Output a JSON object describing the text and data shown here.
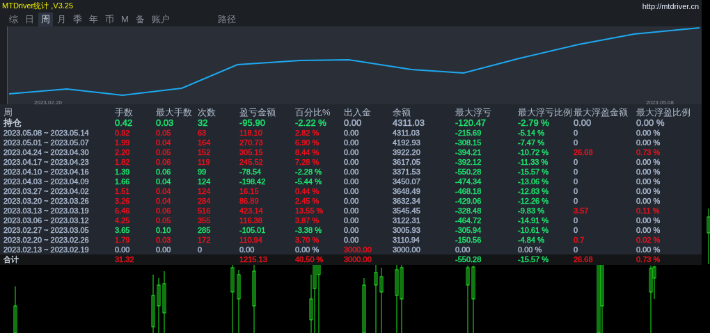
{
  "window": {
    "title": "MTDriver统计 ,V3.25",
    "link": "http://mtdriver.cn"
  },
  "tabs": [
    {
      "label": "综",
      "selected": false
    },
    {
      "label": "日",
      "selected": false
    },
    {
      "label": "周",
      "selected": true
    },
    {
      "label": "月",
      "selected": false
    },
    {
      "label": "季",
      "selected": false
    },
    {
      "label": "年",
      "selected": false
    },
    {
      "label": "币",
      "selected": false
    },
    {
      "label": "M",
      "selected": false
    },
    {
      "label": "备",
      "selected": false
    },
    {
      "label": "账户",
      "selected": false
    },
    {
      "label": "路径",
      "selected": false
    }
  ],
  "equity_chart": {
    "start_date": "2023.02.20",
    "end_date": "2023.05.08"
  },
  "table": {
    "columns": [
      "周",
      "手数",
      "最大手数",
      "次数",
      "盈亏金额",
      "百分比%",
      "出入金",
      "余额",
      "最大浮亏",
      "最大浮亏比例",
      "最大浮盈金额",
      "最大浮盈比例"
    ],
    "rows": [
      {
        "kind": "open",
        "cells": [
          {
            "text": "持仓",
            "color": "#c9d2de"
          },
          {
            "text": "0.42",
            "color": "#1ee870"
          },
          {
            "text": "0.03",
            "color": "#1ee870"
          },
          {
            "text": "32",
            "color": "#1ee870"
          },
          {
            "text": "-95.90",
            "color": "#1ee870"
          },
          {
            "text": "-2.22 %",
            "color": "#1ee870"
          },
          {
            "text": "0.00",
            "color": "#a9b8cf"
          },
          {
            "text": "4311.03",
            "color": "#a9b8cf"
          },
          {
            "text": "-120.47",
            "color": "#1ee870"
          },
          {
            "text": "-2.79 %",
            "color": "#1ee870"
          },
          {
            "text": "0.00",
            "color": "#a9b8cf"
          },
          {
            "text": "0.00 %",
            "color": "#a9b8cf"
          }
        ]
      },
      {
        "kind": "week",
        "cells": [
          {
            "text": "2023.05.08 ~ 2023.05.14",
            "color": "#a9b8cf"
          },
          {
            "text": "0.92",
            "color": "#f0101c"
          },
          {
            "text": "0.05",
            "color": "#f0101c"
          },
          {
            "text": "63",
            "color": "#f0101c"
          },
          {
            "text": "118.10",
            "color": "#f0101c"
          },
          {
            "text": "2.82 %",
            "color": "#f0101c"
          },
          {
            "text": "0.00",
            "color": "#a9b8cf"
          },
          {
            "text": "4311.03",
            "color": "#a9b8cf"
          },
          {
            "text": "-215.69",
            "color": "#1ee870"
          },
          {
            "text": "-5.14 %",
            "color": "#1ee870"
          },
          {
            "text": "0",
            "color": "#a9b8cf"
          },
          {
            "text": "0.00 %",
            "color": "#a9b8cf"
          }
        ]
      },
      {
        "kind": "week",
        "cells": [
          {
            "text": "2023.05.01 ~ 2023.05.07",
            "color": "#a9b8cf"
          },
          {
            "text": "1.99",
            "color": "#f0101c"
          },
          {
            "text": "0.04",
            "color": "#f0101c"
          },
          {
            "text": "164",
            "color": "#f0101c"
          },
          {
            "text": "270.73",
            "color": "#f0101c"
          },
          {
            "text": "6.90 %",
            "color": "#f0101c"
          },
          {
            "text": "0.00",
            "color": "#a9b8cf"
          },
          {
            "text": "4192.93",
            "color": "#a9b8cf"
          },
          {
            "text": "-308.15",
            "color": "#1ee870"
          },
          {
            "text": "-7.47 %",
            "color": "#1ee870"
          },
          {
            "text": "0",
            "color": "#a9b8cf"
          },
          {
            "text": "0.00 %",
            "color": "#a9b8cf"
          }
        ]
      },
      {
        "kind": "week",
        "cells": [
          {
            "text": "2023.04.24 ~ 2023.04.30",
            "color": "#a9b8cf"
          },
          {
            "text": "2.20",
            "color": "#f0101c"
          },
          {
            "text": "0.05",
            "color": "#f0101c"
          },
          {
            "text": "152",
            "color": "#f0101c"
          },
          {
            "text": "305.15",
            "color": "#f0101c"
          },
          {
            "text": "8.44 %",
            "color": "#f0101c"
          },
          {
            "text": "0.00",
            "color": "#a9b8cf"
          },
          {
            "text": "3922.20",
            "color": "#a9b8cf"
          },
          {
            "text": "-394.21",
            "color": "#1ee870"
          },
          {
            "text": "-10.72 %",
            "color": "#1ee870"
          },
          {
            "text": "26.68",
            "color": "#f0101c"
          },
          {
            "text": "0.73 %",
            "color": "#f0101c"
          }
        ]
      },
      {
        "kind": "week",
        "cells": [
          {
            "text": "2023.04.17 ~ 2023.04.23",
            "color": "#a9b8cf"
          },
          {
            "text": "1.82",
            "color": "#f0101c"
          },
          {
            "text": "0.06",
            "color": "#f0101c"
          },
          {
            "text": "119",
            "color": "#f0101c"
          },
          {
            "text": "245.52",
            "color": "#f0101c"
          },
          {
            "text": "7.28 %",
            "color": "#f0101c"
          },
          {
            "text": "0.00",
            "color": "#a9b8cf"
          },
          {
            "text": "3617.05",
            "color": "#a9b8cf"
          },
          {
            "text": "-392.12",
            "color": "#1ee870"
          },
          {
            "text": "-11.33 %",
            "color": "#1ee870"
          },
          {
            "text": "0",
            "color": "#a9b8cf"
          },
          {
            "text": "0.00 %",
            "color": "#a9b8cf"
          }
        ]
      },
      {
        "kind": "week",
        "cells": [
          {
            "text": "2023.04.10 ~ 2023.04.16",
            "color": "#a9b8cf"
          },
          {
            "text": "1.39",
            "color": "#1ee870"
          },
          {
            "text": "0.06",
            "color": "#1ee870"
          },
          {
            "text": "99",
            "color": "#1ee870"
          },
          {
            "text": "-78.54",
            "color": "#1ee870"
          },
          {
            "text": "-2.28 %",
            "color": "#1ee870"
          },
          {
            "text": "0.00",
            "color": "#a9b8cf"
          },
          {
            "text": "3371.53",
            "color": "#a9b8cf"
          },
          {
            "text": "-550.28",
            "color": "#1ee870"
          },
          {
            "text": "-15.57 %",
            "color": "#1ee870"
          },
          {
            "text": "0",
            "color": "#a9b8cf"
          },
          {
            "text": "0.00 %",
            "color": "#a9b8cf"
          }
        ]
      },
      {
        "kind": "week",
        "cells": [
          {
            "text": "2023.04.03 ~ 2023.04.09",
            "color": "#a9b8cf"
          },
          {
            "text": "1.66",
            "color": "#1ee870"
          },
          {
            "text": "0.04",
            "color": "#1ee870"
          },
          {
            "text": "124",
            "color": "#1ee870"
          },
          {
            "text": "-198.42",
            "color": "#1ee870"
          },
          {
            "text": "-5.44 %",
            "color": "#1ee870"
          },
          {
            "text": "0.00",
            "color": "#a9b8cf"
          },
          {
            "text": "3450.07",
            "color": "#a9b8cf"
          },
          {
            "text": "-474.34",
            "color": "#1ee870"
          },
          {
            "text": "-13.06 %",
            "color": "#1ee870"
          },
          {
            "text": "0",
            "color": "#a9b8cf"
          },
          {
            "text": "0.00 %",
            "color": "#a9b8cf"
          }
        ]
      },
      {
        "kind": "week",
        "cells": [
          {
            "text": "2023.03.27 ~ 2023.04.02",
            "color": "#a9b8cf"
          },
          {
            "text": "1.51",
            "color": "#f0101c"
          },
          {
            "text": "0.04",
            "color": "#f0101c"
          },
          {
            "text": "124",
            "color": "#f0101c"
          },
          {
            "text": "16.15",
            "color": "#f0101c"
          },
          {
            "text": "0.44 %",
            "color": "#f0101c"
          },
          {
            "text": "0.00",
            "color": "#a9b8cf"
          },
          {
            "text": "3648.49",
            "color": "#a9b8cf"
          },
          {
            "text": "-468.18",
            "color": "#1ee870"
          },
          {
            "text": "-12.83 %",
            "color": "#1ee870"
          },
          {
            "text": "0",
            "color": "#a9b8cf"
          },
          {
            "text": "0.00 %",
            "color": "#a9b8cf"
          }
        ]
      },
      {
        "kind": "week",
        "cells": [
          {
            "text": "2023.03.20 ~ 2023.03.26",
            "color": "#a9b8cf"
          },
          {
            "text": "3.26",
            "color": "#f0101c"
          },
          {
            "text": "0.04",
            "color": "#f0101c"
          },
          {
            "text": "284",
            "color": "#f0101c"
          },
          {
            "text": "86.89",
            "color": "#f0101c"
          },
          {
            "text": "2.45 %",
            "color": "#f0101c"
          },
          {
            "text": "0.00",
            "color": "#a9b8cf"
          },
          {
            "text": "3632.34",
            "color": "#a9b8cf"
          },
          {
            "text": "-429.06",
            "color": "#1ee870"
          },
          {
            "text": "-12.26 %",
            "color": "#1ee870"
          },
          {
            "text": "0",
            "color": "#a9b8cf"
          },
          {
            "text": "0.00 %",
            "color": "#a9b8cf"
          }
        ]
      },
      {
        "kind": "week",
        "cells": [
          {
            "text": "2023.03.13 ~ 2023.03.19",
            "color": "#a9b8cf"
          },
          {
            "text": "6.46",
            "color": "#f0101c"
          },
          {
            "text": "0.06",
            "color": "#f0101c"
          },
          {
            "text": "516",
            "color": "#f0101c"
          },
          {
            "text": "423.14",
            "color": "#f0101c"
          },
          {
            "text": "13.55 %",
            "color": "#f0101c"
          },
          {
            "text": "0.00",
            "color": "#a9b8cf"
          },
          {
            "text": "3545.45",
            "color": "#a9b8cf"
          },
          {
            "text": "-328.48",
            "color": "#1ee870"
          },
          {
            "text": "-9.83 %",
            "color": "#1ee870"
          },
          {
            "text": "3.57",
            "color": "#f0101c"
          },
          {
            "text": "0.11 %",
            "color": "#f0101c"
          }
        ]
      },
      {
        "kind": "week",
        "cells": [
          {
            "text": "2023.03.06 ~ 2023.03.12",
            "color": "#a9b8cf"
          },
          {
            "text": "4.25",
            "color": "#f0101c"
          },
          {
            "text": "0.05",
            "color": "#f0101c"
          },
          {
            "text": "355",
            "color": "#f0101c"
          },
          {
            "text": "116.38",
            "color": "#f0101c"
          },
          {
            "text": "3.87 %",
            "color": "#f0101c"
          },
          {
            "text": "0.00",
            "color": "#a9b8cf"
          },
          {
            "text": "3122.31",
            "color": "#a9b8cf"
          },
          {
            "text": "-464.72",
            "color": "#1ee870"
          },
          {
            "text": "-14.91 %",
            "color": "#1ee870"
          },
          {
            "text": "0",
            "color": "#a9b8cf"
          },
          {
            "text": "0.00 %",
            "color": "#a9b8cf"
          }
        ]
      },
      {
        "kind": "week",
        "cells": [
          {
            "text": "2023.02.27 ~ 2023.03.05",
            "color": "#a9b8cf"
          },
          {
            "text": "3.65",
            "color": "#1ee870"
          },
          {
            "text": "0.10",
            "color": "#1ee870"
          },
          {
            "text": "285",
            "color": "#1ee870"
          },
          {
            "text": "-105.01",
            "color": "#1ee870"
          },
          {
            "text": "-3.38 %",
            "color": "#1ee870"
          },
          {
            "text": "0.00",
            "color": "#a9b8cf"
          },
          {
            "text": "3005.93",
            "color": "#a9b8cf"
          },
          {
            "text": "-305.94",
            "color": "#1ee870"
          },
          {
            "text": "-10.61 %",
            "color": "#1ee870"
          },
          {
            "text": "0",
            "color": "#a9b8cf"
          },
          {
            "text": "0.00 %",
            "color": "#a9b8cf"
          }
        ]
      },
      {
        "kind": "week",
        "cells": [
          {
            "text": "2023.02.20 ~ 2023.02.26",
            "color": "#a9b8cf"
          },
          {
            "text": "1.79",
            "color": "#f0101c"
          },
          {
            "text": "0.03",
            "color": "#f0101c"
          },
          {
            "text": "172",
            "color": "#f0101c"
          },
          {
            "text": "110.94",
            "color": "#f0101c"
          },
          {
            "text": "3.70 %",
            "color": "#f0101c"
          },
          {
            "text": "0.00",
            "color": "#a9b8cf"
          },
          {
            "text": "3110.94",
            "color": "#a9b8cf"
          },
          {
            "text": "-150.56",
            "color": "#1ee870"
          },
          {
            "text": "-4.84 %",
            "color": "#1ee870"
          },
          {
            "text": "0.7",
            "color": "#f0101c"
          },
          {
            "text": "0.02 %",
            "color": "#f0101c"
          }
        ]
      },
      {
        "kind": "week",
        "cells": [
          {
            "text": "2023.02.13 ~ 2023.02.19",
            "color": "#a9b8cf"
          },
          {
            "text": "0.00",
            "color": "#a9b8cf"
          },
          {
            "text": "0.00",
            "color": "#a9b8cf"
          },
          {
            "text": "0",
            "color": "#a9b8cf"
          },
          {
            "text": "0.00",
            "color": "#a9b8cf"
          },
          {
            "text": "0.00 %",
            "color": "#a9b8cf"
          },
          {
            "text": "3000.00",
            "color": "#f0101c"
          },
          {
            "text": "3000.00",
            "color": "#a9b8cf"
          },
          {
            "text": "0.00",
            "color": "#a9b8cf"
          },
          {
            "text": "0.00 %",
            "color": "#a9b8cf"
          },
          {
            "text": "0",
            "color": "#a9b8cf"
          },
          {
            "text": "0.00 %",
            "color": "#a9b8cf"
          }
        ]
      },
      {
        "kind": "total",
        "cells": [
          {
            "text": "合计",
            "color": "#c9d2de"
          },
          {
            "text": "31.32",
            "color": "#f0101c"
          },
          null,
          null,
          {
            "text": "1215.13",
            "color": "#f0101c"
          },
          {
            "text": "40.50 %",
            "color": "#f0101c"
          },
          {
            "text": "3000.00",
            "color": "#f0101c"
          },
          null,
          {
            "text": "-550.28",
            "color": "#1ee870"
          },
          {
            "text": "-15.57 %",
            "color": "#1ee870"
          },
          {
            "text": "26.68",
            "color": "#f0101c"
          },
          {
            "text": "0.73 %",
            "color": "#f0101c"
          }
        ]
      }
    ]
  }
}
